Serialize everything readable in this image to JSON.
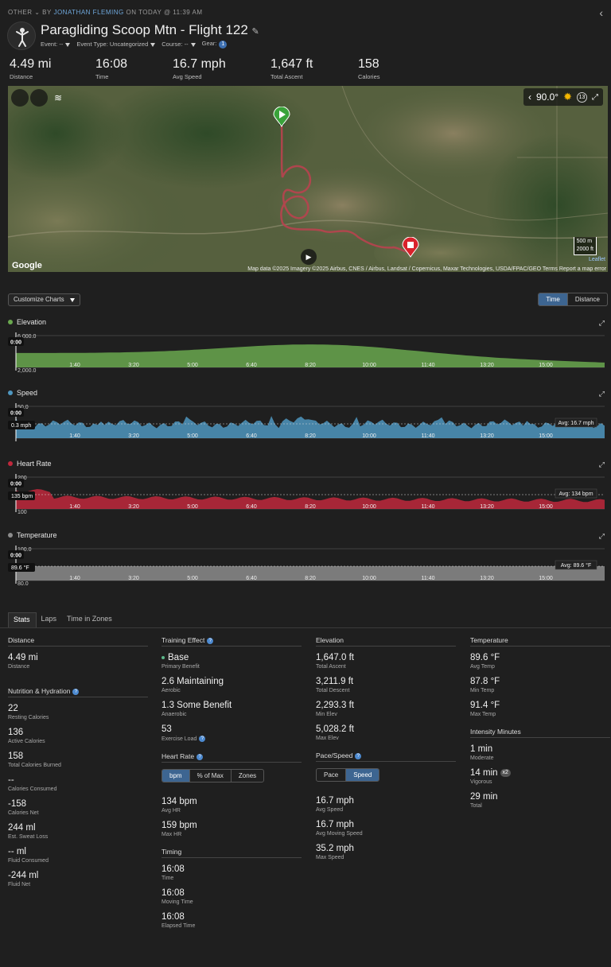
{
  "header": {
    "category": "OTHER",
    "by": "BY",
    "author": "JONATHAN FLEMING",
    "when": "ON TODAY @ 11:39 AM",
    "title": "Paragliding Scoop Mtn - Flight 122",
    "event_label": "Event: --",
    "event_type_label": "Event Type: Uncategorized",
    "course_label": "Course: --",
    "gear_label": "Gear:",
    "gear_count": "1"
  },
  "summary": [
    {
      "value": "4.49 mi",
      "label": "Distance"
    },
    {
      "value": "16:08",
      "label": "Time"
    },
    {
      "value": "16.7 mph",
      "label": "Avg Speed"
    },
    {
      "value": "1,647 ft",
      "label": "Total Ascent"
    },
    {
      "value": "158",
      "label": "Calories"
    }
  ],
  "map": {
    "temperature": "90.0°",
    "weather_icon": "sun-icon",
    "weather_badge": "13",
    "scale_m": "500 m",
    "scale_ft": "2000 ft",
    "provider": "Google",
    "leaflet": "Leaflet",
    "attribution": "Map data ©2025 Imagery ©2025 Airbus, CNES / Airbus, Landsat / Copernicus, Maxar Technologies, USDA/FPAC/GEO   Terms   Report a map error"
  },
  "controls": {
    "customize": "Customize Charts",
    "axis_time": "Time",
    "axis_distance": "Distance"
  },
  "x_ticks": [
    "1:40",
    "3:20",
    "5:00",
    "6:40",
    "8:20",
    "10:00",
    "11:40",
    "13:20",
    "15:00"
  ],
  "charts": [
    {
      "title": "Elevation",
      "color": "#6aa84f",
      "top_label": "6,000.0",
      "bottom_label": "2,000.0",
      "cursor": "0:00",
      "avg": ""
    },
    {
      "title": "Speed",
      "color": "#4f97c0",
      "top_label": "50.0",
      "bottom_label": "",
      "cursor": "0:00",
      "value": "0.3 mph",
      "avg": "Avg: 16.7 mph"
    },
    {
      "title": "Heart Rate",
      "color": "#c0283c",
      "top_label": "200",
      "bottom_label": "100",
      "cursor": "0:00",
      "value": "135 bpm",
      "avg": "Avg: 134 bpm"
    },
    {
      "title": "Temperature",
      "color": "#8c8c8c",
      "top_label": "100.0",
      "bottom_label": "80.0",
      "cursor": "0:00",
      "value": "89.6 °F",
      "avg": "Avg: 89.6 °F"
    }
  ],
  "tabs": [
    "Stats",
    "Laps",
    "Time in Zones"
  ],
  "stats": {
    "distance": {
      "title": "Distance",
      "value": "4.49 mi",
      "label": "Distance"
    },
    "nutrition": {
      "title": "Nutrition & Hydration",
      "items": [
        {
          "value": "22",
          "label": "Resting Calories"
        },
        {
          "value": "136",
          "label": "Active Calories"
        },
        {
          "value": "158",
          "label": "Total Calories Burned"
        },
        {
          "value": "--",
          "label": "Calories Consumed"
        },
        {
          "value": "-158",
          "label": "Calories Net"
        },
        {
          "value": "244 ml",
          "label": "Est. Sweat Loss"
        },
        {
          "value": "-- ml",
          "label": "Fluid Consumed"
        },
        {
          "value": "-244 ml",
          "label": "Fluid Net"
        }
      ]
    },
    "training": {
      "title": "Training Effect",
      "primary": {
        "value": "Base",
        "label": "Primary Benefit"
      },
      "aerobic": {
        "value": "2.6 Maintaining",
        "label": "Aerobic"
      },
      "anaerobic": {
        "value": "1.3 Some Benefit",
        "label": "Anaerobic"
      },
      "load": {
        "value": "53",
        "label": "Exercise Load"
      }
    },
    "heart_rate": {
      "title": "Heart Rate",
      "toggle": [
        "bpm",
        "% of Max",
        "Zones"
      ],
      "avg": {
        "value": "134 bpm",
        "label": "Avg HR"
      },
      "max": {
        "value": "159 bpm",
        "label": "Max HR"
      }
    },
    "timing": {
      "title": "Timing",
      "items": [
        {
          "value": "16:08",
          "label": "Time"
        },
        {
          "value": "16:08",
          "label": "Moving Time"
        },
        {
          "value": "16:08",
          "label": "Elapsed Time"
        }
      ]
    },
    "elevation": {
      "title": "Elevation",
      "items": [
        {
          "value": "1,647.0 ft",
          "label": "Total Ascent"
        },
        {
          "value": "3,211.9 ft",
          "label": "Total Descent"
        },
        {
          "value": "2,293.3 ft",
          "label": "Min Elev"
        },
        {
          "value": "5,028.2 ft",
          "label": "Max Elev"
        }
      ]
    },
    "pace": {
      "title": "Pace/Speed",
      "toggle": [
        "Pace",
        "Speed"
      ],
      "items": [
        {
          "value": "16.7 mph",
          "label": "Avg Speed"
        },
        {
          "value": "16.7 mph",
          "label": "Avg Moving Speed"
        },
        {
          "value": "35.2 mph",
          "label": "Max Speed"
        }
      ]
    },
    "temperature": {
      "title": "Temperature",
      "items": [
        {
          "value": "89.6 °F",
          "label": "Avg Temp"
        },
        {
          "value": "87.8 °F",
          "label": "Min Temp"
        },
        {
          "value": "91.4 °F",
          "label": "Max Temp"
        }
      ]
    },
    "intensity": {
      "title": "Intensity Minutes",
      "moderate": {
        "value": "1 min",
        "label": "Moderate"
      },
      "vigorous": {
        "value": "14 min",
        "label": "Vigorous",
        "badge": "x2"
      },
      "total": {
        "value": "29 min",
        "label": "Total"
      }
    }
  }
}
